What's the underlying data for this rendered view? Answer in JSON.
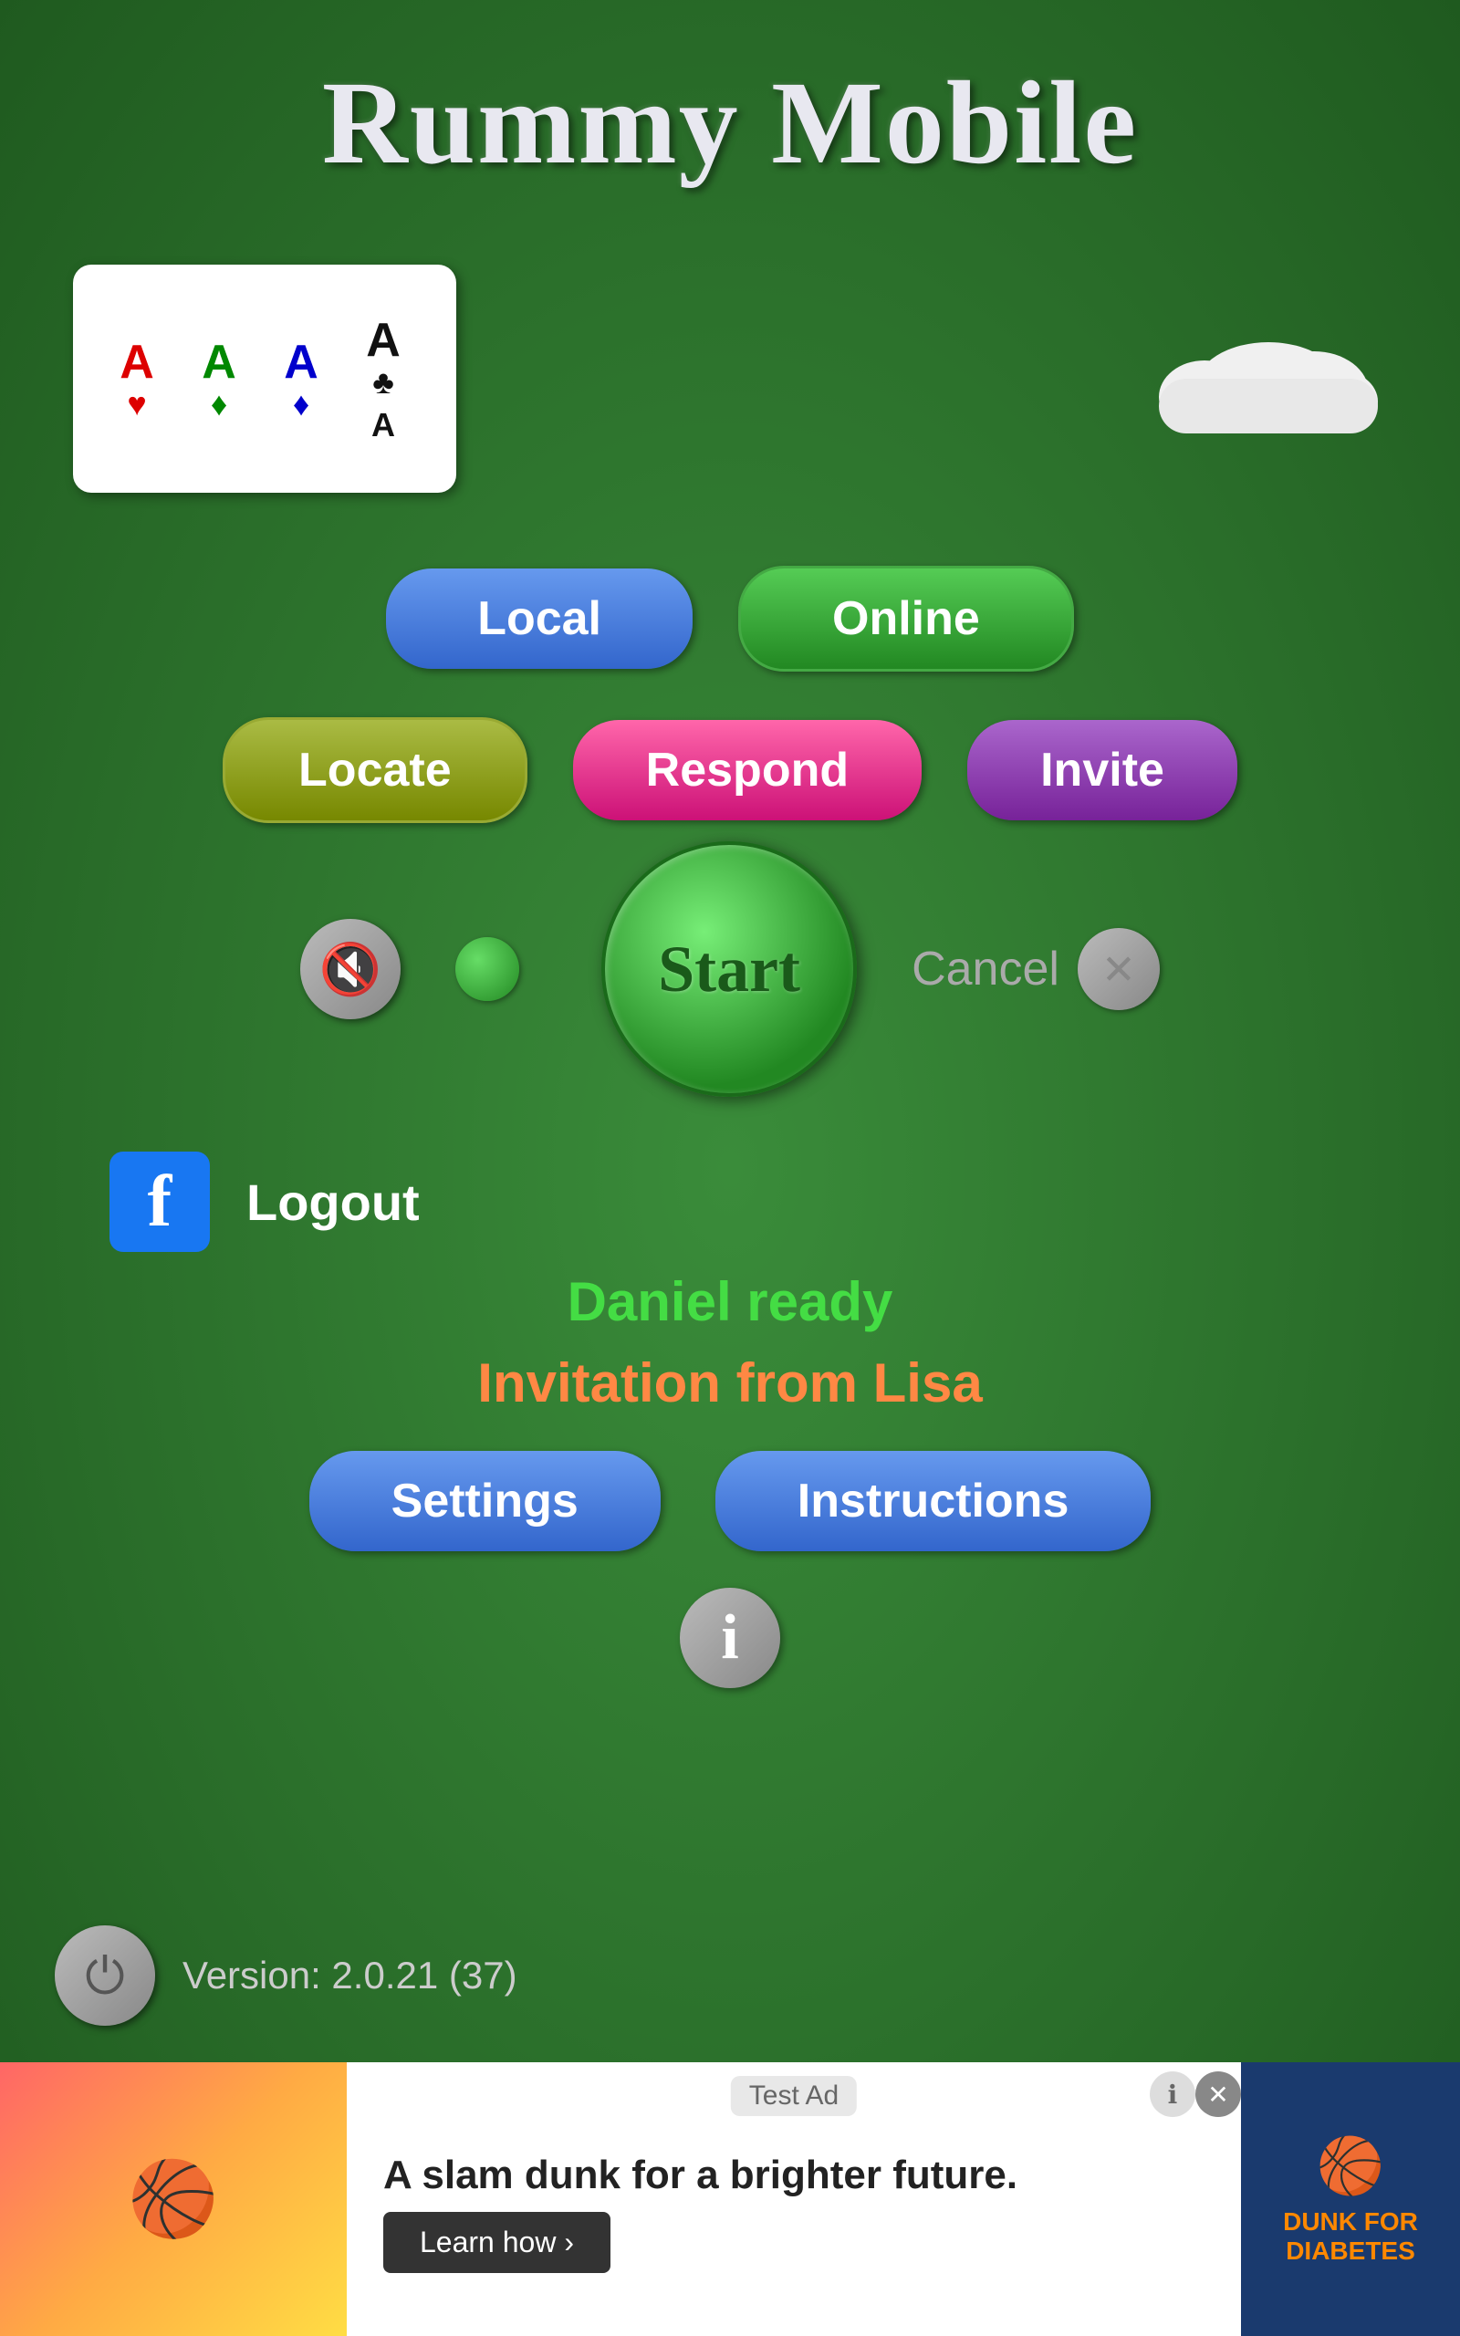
{
  "title": "Rummy Mobile",
  "cards": [
    {
      "letter": "A",
      "suit": "♥",
      "color": "red"
    },
    {
      "letter": "A",
      "suit": "♦",
      "color": "green"
    },
    {
      "letter": "A",
      "suit": "♦",
      "color": "blue"
    },
    {
      "letter": "A",
      "suit": "♣",
      "color": "black"
    }
  ],
  "buttons": {
    "local": "Local",
    "online": "Online",
    "locate": "Locate",
    "respond": "Respond",
    "invite": "Invite",
    "start": "Start",
    "cancel": "Cancel",
    "logout": "Logout",
    "settings": "Settings",
    "instructions": "Instructions"
  },
  "status": {
    "player_ready": "Daniel ready",
    "invitation": "Invitation from Lisa"
  },
  "version": "Version: 2.0.21 (37)",
  "ad": {
    "label": "Test Ad",
    "text": "A slam dunk for a brighter future.",
    "learn_more": "Learn how ›",
    "logo": "DUNK FOR DIABETES"
  }
}
